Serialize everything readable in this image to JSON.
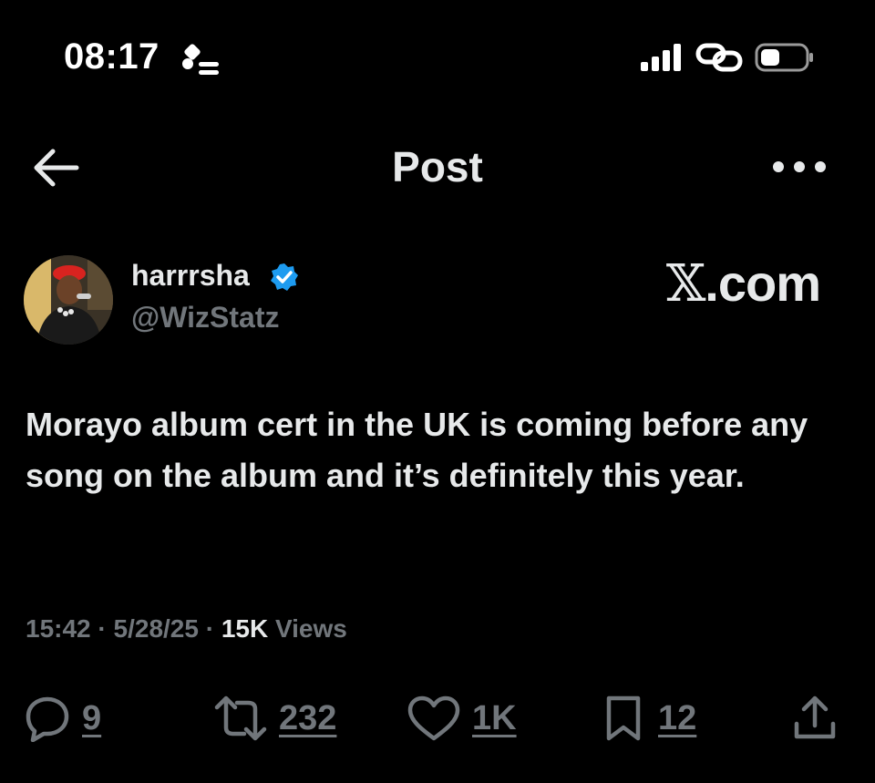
{
  "status_bar": {
    "time": "08:17"
  },
  "header": {
    "title": "Post"
  },
  "author": {
    "display_name": "harrrsha",
    "handle": "@WizStatz",
    "verified": true
  },
  "watermark": {
    "x_glyph": "𝕏",
    "suffix": ".com"
  },
  "post": {
    "text": "Morayo album cert in the UK is coming before any song on the album and it’s definitely this year."
  },
  "meta": {
    "time": "15:42",
    "separator": "·",
    "date": "5/28/25",
    "views_count": "15K",
    "views_label": "Views"
  },
  "actions": {
    "replies": "9",
    "reposts": "232",
    "likes": "1K",
    "bookmarks": "12"
  },
  "colors": {
    "background": "#000000",
    "text_primary": "#e7e9ea",
    "text_secondary": "#71767b",
    "verified_blue": "#1d9bf0"
  },
  "icons": [
    "focus-icon",
    "signal-icon",
    "link-icon",
    "battery-icon",
    "back-arrow-icon",
    "more-icon",
    "verified-icon",
    "reply-icon",
    "repost-icon",
    "like-icon",
    "bookmark-icon",
    "share-icon"
  ]
}
